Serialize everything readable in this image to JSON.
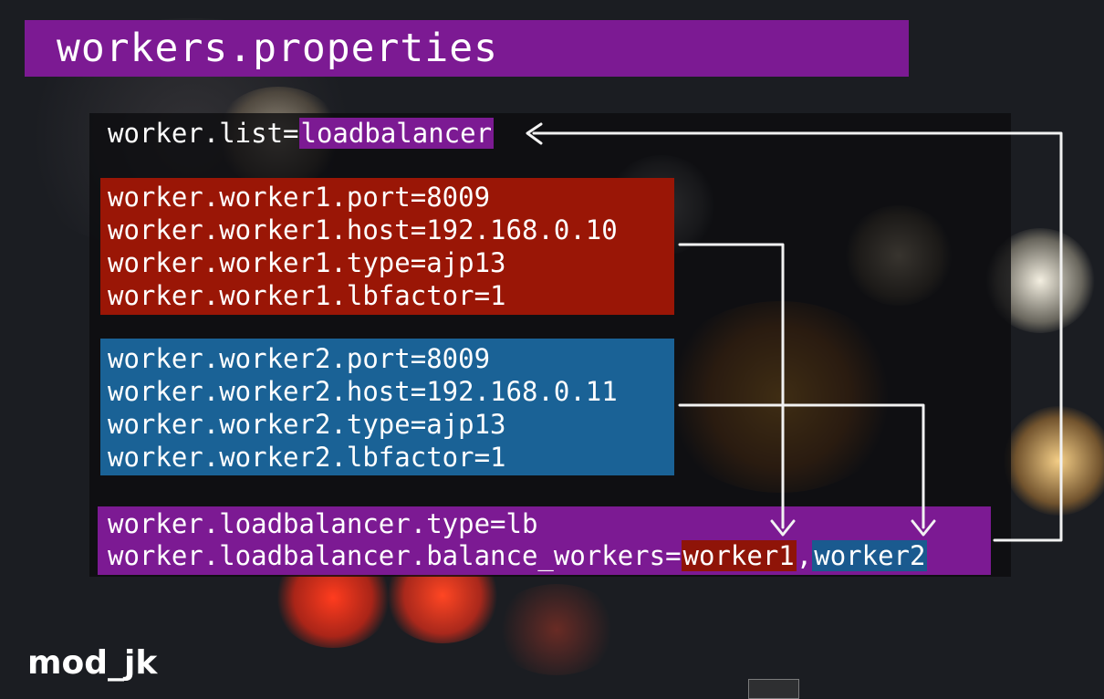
{
  "slide": {
    "title": "workers.properties",
    "brand": "mod_jk"
  },
  "code": {
    "list_prefix": "worker.list=",
    "list_value": "loadbalancer",
    "worker1": [
      "worker.worker1.port=8009",
      "worker.worker1.host=192.168.0.10",
      "worker.worker1.type=ajp13",
      "worker.worker1.lbfactor=1"
    ],
    "worker2": [
      "worker.worker2.port=8009",
      "worker.worker2.host=192.168.0.11",
      "worker.worker2.type=ajp13",
      "worker.worker2.lbfactor=1"
    ],
    "lb_type": "worker.loadbalancer.type=lb",
    "lb_workers_prefix": "worker.loadbalancer.balance_workers=",
    "lb_worker1": "worker1",
    "lb_separator": ",",
    "lb_worker2": "worker2"
  },
  "colors": {
    "accent_purple": "#7c1a93",
    "worker1_red": "#9a1606",
    "worker2_blue": "#1a6296"
  }
}
